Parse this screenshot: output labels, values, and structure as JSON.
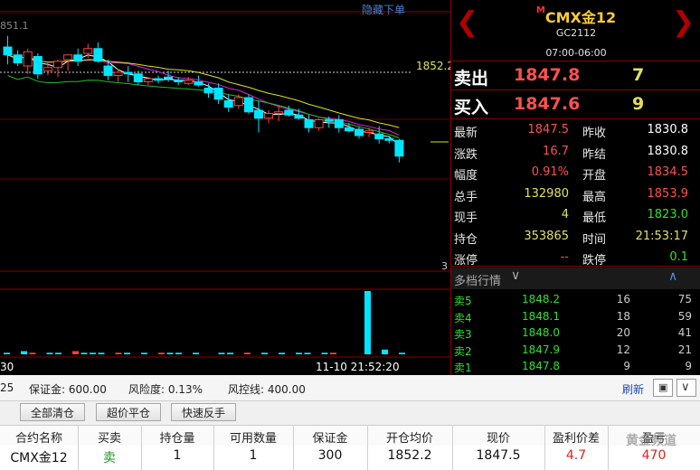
{
  "chart": {
    "top_price_label": "851.1",
    "hide_orders_label": "隐藏下单",
    "price_tag": "1852.2",
    "volume_axis_label": "3",
    "time_label_left": "30",
    "time_label": "11-10 21:52:20",
    "candles": [
      {
        "o": 1853.8,
        "h": 1854.5,
        "l": 1852.7,
        "c": 1853.3
      },
      {
        "o": 1853.3,
        "h": 1853.6,
        "l": 1852.6,
        "c": 1852.8
      },
      {
        "o": 1852.6,
        "h": 1853.7,
        "l": 1852.1,
        "c": 1853.5
      },
      {
        "o": 1853.2,
        "h": 1853.4,
        "l": 1851.8,
        "c": 1852.1
      },
      {
        "o": 1852.3,
        "h": 1852.9,
        "l": 1852.0,
        "c": 1852.5
      },
      {
        "o": 1852.5,
        "h": 1853.0,
        "l": 1851.9,
        "c": 1852.9
      },
      {
        "o": 1853.0,
        "h": 1853.3,
        "l": 1852.3,
        "c": 1853.3
      },
      {
        "o": 1853.3,
        "h": 1853.7,
        "l": 1852.6,
        "c": 1852.9
      },
      {
        "o": 1853.4,
        "h": 1854.0,
        "l": 1853.1,
        "c": 1853.7
      },
      {
        "o": 1853.7,
        "h": 1854.1,
        "l": 1852.8,
        "c": 1852.9
      },
      {
        "o": 1852.6,
        "h": 1853.0,
        "l": 1851.7,
        "c": 1852.0
      },
      {
        "o": 1852.0,
        "h": 1852.4,
        "l": 1851.6,
        "c": 1852.2
      },
      {
        "o": 1852.2,
        "h": 1852.6,
        "l": 1851.6,
        "c": 1852.1
      },
      {
        "o": 1852.1,
        "h": 1852.3,
        "l": 1851.4,
        "c": 1851.6
      },
      {
        "o": 1851.6,
        "h": 1851.9,
        "l": 1851.4,
        "c": 1851.8
      },
      {
        "o": 1851.8,
        "h": 1852.0,
        "l": 1851.5,
        "c": 1851.7
      },
      {
        "o": 1851.9,
        "h": 1852.3,
        "l": 1851.6,
        "c": 1851.8
      },
      {
        "o": 1851.7,
        "h": 1851.9,
        "l": 1851.4,
        "c": 1851.6
      },
      {
        "o": 1851.5,
        "h": 1851.9,
        "l": 1851.4,
        "c": 1851.7
      },
      {
        "o": 1851.6,
        "h": 1852.0,
        "l": 1851.3,
        "c": 1851.4
      },
      {
        "o": 1851.2,
        "h": 1851.5,
        "l": 1850.6,
        "c": 1850.9
      },
      {
        "o": 1851.2,
        "h": 1851.5,
        "l": 1850.2,
        "c": 1850.5
      },
      {
        "o": 1850.4,
        "h": 1850.8,
        "l": 1849.7,
        "c": 1850.0
      },
      {
        "o": 1850.1,
        "h": 1850.8,
        "l": 1849.9,
        "c": 1850.6
      },
      {
        "o": 1850.6,
        "h": 1850.8,
        "l": 1849.6,
        "c": 1849.7
      },
      {
        "o": 1849.8,
        "h": 1850.4,
        "l": 1848.4,
        "c": 1849.3
      },
      {
        "o": 1849.3,
        "h": 1849.8,
        "l": 1849.0,
        "c": 1849.6
      },
      {
        "o": 1849.6,
        "h": 1850.1,
        "l": 1849.1,
        "c": 1849.7
      },
      {
        "o": 1849.8,
        "h": 1850.1,
        "l": 1849.4,
        "c": 1849.5
      },
      {
        "o": 1849.5,
        "h": 1849.9,
        "l": 1849.2,
        "c": 1849.3
      },
      {
        "o": 1849.2,
        "h": 1849.5,
        "l": 1848.4,
        "c": 1848.7
      },
      {
        "o": 1848.7,
        "h": 1849.3,
        "l": 1848.5,
        "c": 1849.2
      },
      {
        "o": 1849.2,
        "h": 1849.4,
        "l": 1848.7,
        "c": 1849.1
      },
      {
        "o": 1849.2,
        "h": 1849.5,
        "l": 1848.4,
        "c": 1848.7
      },
      {
        "o": 1848.7,
        "h": 1849.0,
        "l": 1848.4,
        "c": 1848.5
      },
      {
        "o": 1848.6,
        "h": 1848.8,
        "l": 1848.0,
        "c": 1848.2
      },
      {
        "o": 1848.4,
        "h": 1848.7,
        "l": 1848.1,
        "c": 1848.5
      },
      {
        "o": 1848.3,
        "h": 1848.8,
        "l": 1847.7,
        "c": 1848.0
      },
      {
        "o": 1848.0,
        "h": 1848.2,
        "l": 1847.7,
        "c": 1847.9
      },
      {
        "o": 1847.9,
        "h": 1848.0,
        "l": 1846.5,
        "c": 1846.9
      }
    ],
    "volumes": [
      1,
      0,
      2,
      1,
      0,
      1,
      1,
      0,
      2,
      1,
      1,
      1,
      0,
      1,
      1,
      0,
      1,
      0,
      1,
      1,
      1,
      0,
      1,
      0,
      0,
      1,
      1,
      0,
      1,
      0,
      1,
      0,
      1,
      0,
      1,
      1,
      0,
      1,
      1,
      0,
      0,
      0,
      40,
      0,
      3,
      0,
      1,
      0
    ],
    "colors": {
      "up": "#ff4040",
      "down": "#00e5ff",
      "ma1": "#ffffff",
      "ma2": "#e020e0",
      "ma3": "#20c020",
      "ma4": "#e0e020"
    }
  },
  "quote": {
    "symbol_prefix": "M",
    "symbol": "CMX金12",
    "code": "GC2112",
    "hours": "07:00-06:00",
    "ask_label": "卖出",
    "ask_price": "1847.8",
    "ask_volume": "7",
    "bid_label": "买入",
    "bid_price": "1847.6",
    "bid_volume": "9",
    "rows": [
      {
        "l1": "最新",
        "v1": "1847.5",
        "c1": "#ff5050",
        "l2": "昨收",
        "v2": "1830.8",
        "c2": "#ffffff"
      },
      {
        "l1": "涨跌",
        "v1": "16.7",
        "c1": "#ff5050",
        "l2": "昨结",
        "v2": "1830.8",
        "c2": "#ffffff"
      },
      {
        "l1": "幅度",
        "v1": "0.91%",
        "c1": "#ff5050",
        "l2": "开盘",
        "v2": "1834.5",
        "c2": "#ff5050"
      },
      {
        "l1": "总手",
        "v1": "132980",
        "c1": "#e0e060",
        "l2": "最高",
        "v2": "1853.9",
        "c2": "#ff5050"
      },
      {
        "l1": "现手",
        "v1": "4",
        "c1": "#e0e060",
        "l2": "最低",
        "v2": "1823.0",
        "c2": "#30e030"
      },
      {
        "l1": "持仓",
        "v1": "353865",
        "c1": "#e0e060",
        "l2": "时间",
        "v2": "21:53:17",
        "c2": "#e0e060"
      },
      {
        "l1": "涨停",
        "v1": "--",
        "c1": "#ff5050",
        "l2": "跌停",
        "v2": "0.1",
        "c2": "#30e030"
      }
    ],
    "depth_title": "多档行情",
    "asks": [
      {
        "label": "卖5",
        "price": "1848.2",
        "vol": "16",
        "n": "75"
      },
      {
        "label": "卖4",
        "price": "1848.1",
        "vol": "18",
        "n": "59"
      },
      {
        "label": "卖3",
        "price": "1848.0",
        "vol": "20",
        "n": "41"
      },
      {
        "label": "卖2",
        "price": "1847.9",
        "vol": "12",
        "n": "21"
      },
      {
        "label": "卖1",
        "price": "1847.8",
        "vol": "9",
        "n": "9"
      }
    ]
  },
  "bottom": {
    "left_fragment": "25",
    "margin_label": "保证金: 600.00",
    "risk_label": "风险度: 0.13%",
    "risk_line_label": "风控线: 400.00",
    "refresh_label": "刷新",
    "buttons": [
      "全部清仓",
      "超价平仓",
      "快速反手"
    ],
    "headers": [
      "合约名称",
      "买卖",
      "持仓量",
      "可用数量",
      "保证金",
      "开仓均价",
      "现价",
      "盈利价差",
      "盈亏"
    ],
    "row": [
      "CMX金12",
      "卖",
      "1",
      "1",
      "300",
      "1852.2",
      "1847.5",
      "4.7",
      "470"
    ],
    "watermark": "黄金频道"
  }
}
